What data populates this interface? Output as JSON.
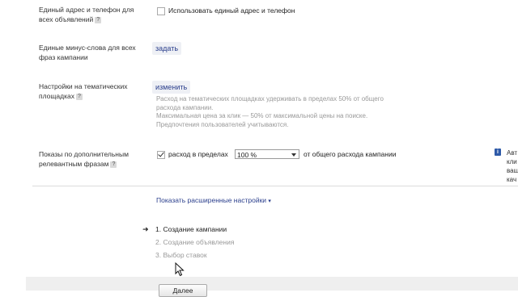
{
  "rows": {
    "address": {
      "label_line1": "Единый адрес и телефон для",
      "label_line2": "всех объявлений",
      "help": "?",
      "checkbox_label": "Использовать единый адрес и телефон",
      "checked": false
    },
    "minus_words": {
      "label_line1": "Единые минус-слова для всех",
      "label_line2": "фраз кампании",
      "action": "задать"
    },
    "thematic": {
      "label_line1": "Настройки на тематических",
      "label_line2": "площадках",
      "help": "?",
      "action": "изменить",
      "desc1": "Расход на тематических площадках удерживать в пределах 50% от общего",
      "desc2": "расхода кампании.",
      "desc3": "Максимальная цена за клик — 50% от максимальной цены на поиске.",
      "desc4": "Предпочтения пользователей учитываются."
    },
    "relevant": {
      "label_line1": "Показы по дополнительным",
      "label_line2": "релевантным фразам",
      "help": "?",
      "checkbox_label": "расход в пределах",
      "checked": true,
      "select_value": "100 %",
      "suffix": "от общего расхода кампании",
      "info_icon": "i",
      "side_text": [
        "Авт",
        "кли",
        "ваш",
        "кач"
      ]
    }
  },
  "advanced_link": "Показать расширенные настройки",
  "advanced_arrow": "▾",
  "steps": [
    {
      "label": "1. Создание кампании",
      "active": true,
      "marker": "➜"
    },
    {
      "label": "2. Создание объявления",
      "active": false
    },
    {
      "label": "3. Выбор ставок",
      "active": false
    }
  ],
  "footer": {
    "button_label": "Далее"
  },
  "colors": {
    "link": "#2a3e8c",
    "muted": "#999999",
    "info": "#2e5aa8"
  }
}
